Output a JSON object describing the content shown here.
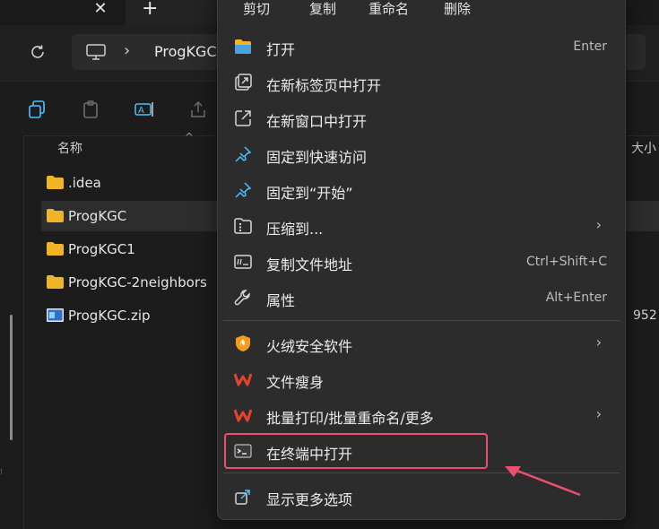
{
  "tabs": {
    "close_glyph": "✕",
    "new_glyph": "+"
  },
  "address": {
    "crumb": "ProgKGC"
  },
  "filelist": {
    "header_name": "名称",
    "header_size": "大小",
    "files": [
      {
        "name": ".idea",
        "type": "folder",
        "selected": false
      },
      {
        "name": "ProgKGC",
        "type": "folder",
        "selected": true
      },
      {
        "name": "ProgKGC1",
        "type": "folder",
        "selected": false
      },
      {
        "name": "ProgKGC-2neighbors",
        "type": "folder",
        "selected": false
      },
      {
        "name": "ProgKGC.zip",
        "type": "zip",
        "selected": false,
        "size": "952"
      }
    ]
  },
  "menu": {
    "quick_actions": [
      "剪切",
      "复制",
      "重命名",
      "删除"
    ],
    "items": [
      {
        "label": "打开",
        "shortcut": "Enter",
        "icon": "folder-open-icon"
      },
      {
        "label": "在新标签页中打开",
        "shortcut": "",
        "icon": "new-tab-icon"
      },
      {
        "label": "在新窗口中打开",
        "shortcut": "",
        "icon": "new-window-icon"
      },
      {
        "label": "固定到快速访问",
        "shortcut": "",
        "icon": "pin-icon"
      },
      {
        "label": "固定到“开始”",
        "shortcut": "",
        "icon": "pin-icon"
      },
      {
        "label": "压缩到...",
        "shortcut": "",
        "icon": "archive-icon",
        "submenu": true
      },
      {
        "label": "复制文件地址",
        "shortcut": "Ctrl+Shift+C",
        "icon": "copy-path-icon"
      },
      {
        "label": "属性",
        "shortcut": "Alt+Enter",
        "icon": "wrench-icon"
      },
      {
        "label": "火绒安全软件",
        "shortcut": "",
        "icon": "shield-icon",
        "submenu": true
      },
      {
        "label": "文件瘦身",
        "shortcut": "",
        "icon": "wps-icon"
      },
      {
        "label": "批量打印/批量重命名/更多",
        "shortcut": "",
        "icon": "wps-icon",
        "submenu": true
      },
      {
        "label": "在终端中打开",
        "shortcut": "",
        "icon": "terminal-icon"
      },
      {
        "label": "显示更多选项",
        "shortcut": "",
        "icon": "more-options-icon"
      }
    ],
    "submenu_glyph": "›"
  },
  "colors": {
    "highlight": "#e8506e",
    "folder": "#f0b429",
    "accent": "#4cc2ff"
  }
}
